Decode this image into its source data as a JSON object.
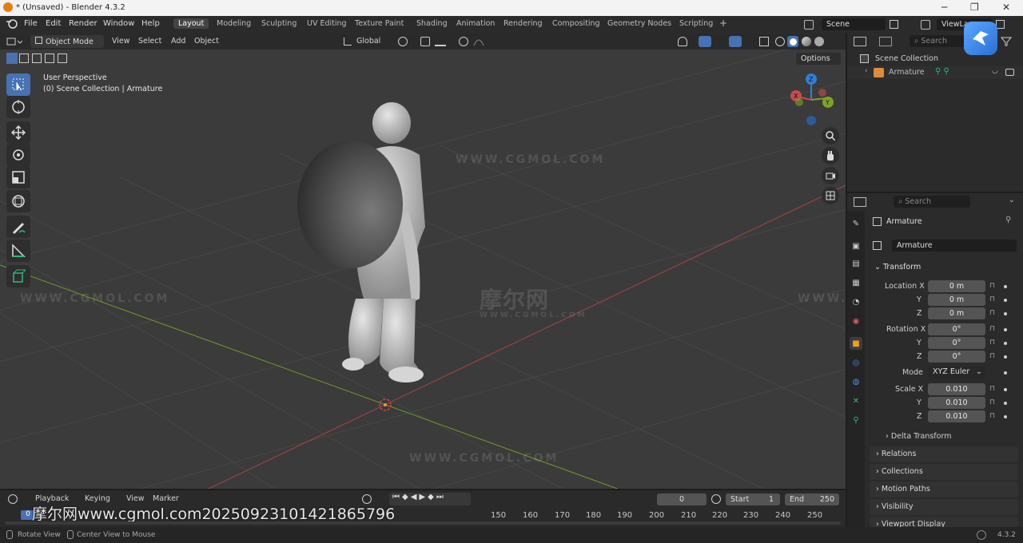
{
  "window": {
    "title": "* (Unsaved) - Blender 4.3.2",
    "minimize": "─",
    "maximize": "❐",
    "close": "✕"
  },
  "menus": [
    "File",
    "Edit",
    "Render",
    "Window",
    "Help"
  ],
  "workspaces": [
    "Layout",
    "Modeling",
    "Sculpting",
    "UV Editing",
    "Texture Paint",
    "Shading",
    "Animation",
    "Rendering",
    "Compositing",
    "Geometry Nodes",
    "Scripting"
  ],
  "workspace_add": "+",
  "scene": {
    "label": "Scene",
    "view_layer": "ViewLayer"
  },
  "viewport_header": {
    "mode": "Object Mode",
    "menu": [
      "View",
      "Select",
      "Add",
      "Object"
    ],
    "transform_orientation": "Global",
    "options": "Options"
  },
  "viewport": {
    "perspective": "User Perspective",
    "collection": "(0) Scene Collection | Armature",
    "gizmo_axes": [
      "Z",
      "X",
      "Y"
    ],
    "watermarks": [
      "WWW.CGMOL.COM",
      "WWW.CGMOL.COM",
      "WWW.CGMOL.COM",
      "WWW.CGMOL.COM",
      "摩尔网",
      "WWW.CGMOL.COM"
    ]
  },
  "outliner": {
    "search_placeholder": "Search",
    "items": [
      "Scene Collection",
      "Armature"
    ]
  },
  "properties": {
    "search_placeholder": "Search",
    "object_name": "Armature",
    "data_name": "Armature",
    "transform_label": "Transform",
    "location": {
      "label": "Location X",
      "x": "0 m",
      "y": "0 m",
      "z": "0 m"
    },
    "rotation": {
      "label": "Rotation X",
      "x": "0°",
      "y": "0°",
      "z": "0°"
    },
    "mode_label": "Mode",
    "mode_value": "XYZ Euler",
    "scale": {
      "label": "Scale X",
      "x": "0.010",
      "y": "0.010",
      "z": "0.010"
    },
    "axis_y": "Y",
    "axis_z": "Z",
    "delta_transform": "Delta Transform",
    "panels": [
      "Relations",
      "Collections",
      "Motion Paths",
      "Visibility",
      "Viewport Display"
    ]
  },
  "timeline": {
    "menu": [
      "Playback",
      "Keying",
      "View",
      "Marker"
    ],
    "current_frame": "0",
    "start_label": "Start",
    "start_value": "1",
    "end_label": "End",
    "end_value": "250",
    "frame_marker": "0",
    "ticks": [
      "150",
      "160",
      "170",
      "180",
      "190",
      "200",
      "210",
      "220",
      "230",
      "240",
      "250"
    ],
    "overlay_text": "摩尔网www.cgmol.com20250923101421865796"
  },
  "statusbar": {
    "rotate_view": "Rotate View",
    "center_view": "Center View to Mouse",
    "version": "4.3.2"
  },
  "colors": {
    "accent": "#4772b3",
    "x_axis": "#c84a4a",
    "y_axis": "#7ba328",
    "z_axis": "#2f7fd6"
  }
}
